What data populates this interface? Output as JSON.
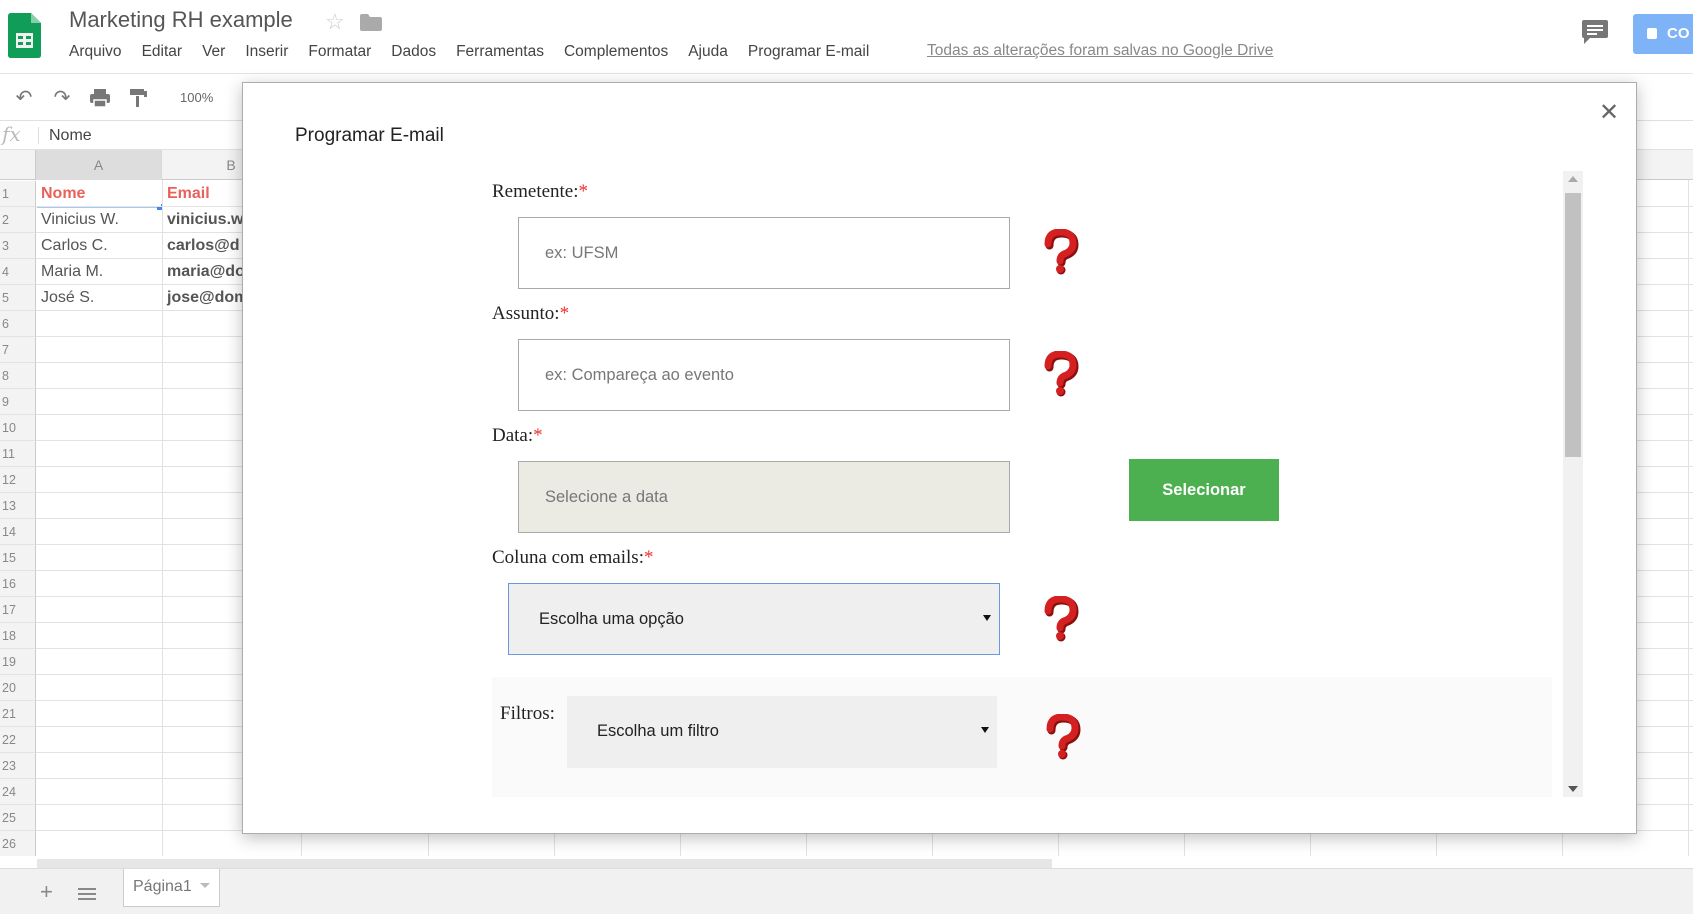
{
  "app": {
    "title": "Marketing RH example",
    "menu": [
      "Arquivo",
      "Editar",
      "Ver",
      "Inserir",
      "Formatar",
      "Dados",
      "Ferramentas",
      "Complementos",
      "Ajuda",
      "Programar E-mail"
    ],
    "save_status": "Todas as alterações foram salvas no Google Drive",
    "share_label": "Co",
    "accent_color": "#0f9d58"
  },
  "toolbar": {
    "zoom": "100%",
    "icons": [
      "undo-icon",
      "redo-icon",
      "print-icon",
      "paint-format-icon"
    ]
  },
  "formula_bar": {
    "fx": "fx",
    "value": "Nome"
  },
  "sheet": {
    "columns": [
      "A",
      "B"
    ],
    "rows": [
      {
        "num": "1",
        "a": "Nome",
        "b": "Email"
      },
      {
        "num": "2",
        "a": "Vinicius W.",
        "b": "vinicius.w"
      },
      {
        "num": "3",
        "a": "Carlos C.",
        "b": "carlos@d"
      },
      {
        "num": "4",
        "a": "Maria M.",
        "b": "maria@do"
      },
      {
        "num": "5",
        "a": "José S.",
        "b": "jose@dom"
      },
      {
        "num": "6"
      },
      {
        "num": "7"
      },
      {
        "num": "8"
      },
      {
        "num": "9"
      },
      {
        "num": "10"
      },
      {
        "num": "11"
      },
      {
        "num": "12"
      },
      {
        "num": "13"
      },
      {
        "num": "14"
      },
      {
        "num": "15"
      },
      {
        "num": "16"
      },
      {
        "num": "17"
      },
      {
        "num": "18"
      },
      {
        "num": "19"
      },
      {
        "num": "20"
      },
      {
        "num": "21"
      },
      {
        "num": "22"
      },
      {
        "num": "23"
      },
      {
        "num": "24"
      },
      {
        "num": "25"
      },
      {
        "num": "26"
      }
    ],
    "tab_name": "Página1"
  },
  "dialog": {
    "title": "Programar E-mail",
    "required_mark": "*",
    "remetente": {
      "label": "Remetente:",
      "placeholder": "ex: UFSM"
    },
    "assunto": {
      "label": "Assunto:",
      "placeholder": "ex: Compareça ao evento"
    },
    "data": {
      "label": "Data:",
      "placeholder": "Selecione a data",
      "button": "Selecionar"
    },
    "coluna": {
      "label": "Coluna com emails:",
      "selected": "Escolha uma opção"
    },
    "filtros": {
      "label": "Filtros:",
      "selected": "Escolha um filtro"
    },
    "help_color": "#d42020",
    "button_color": "#4caf50"
  }
}
